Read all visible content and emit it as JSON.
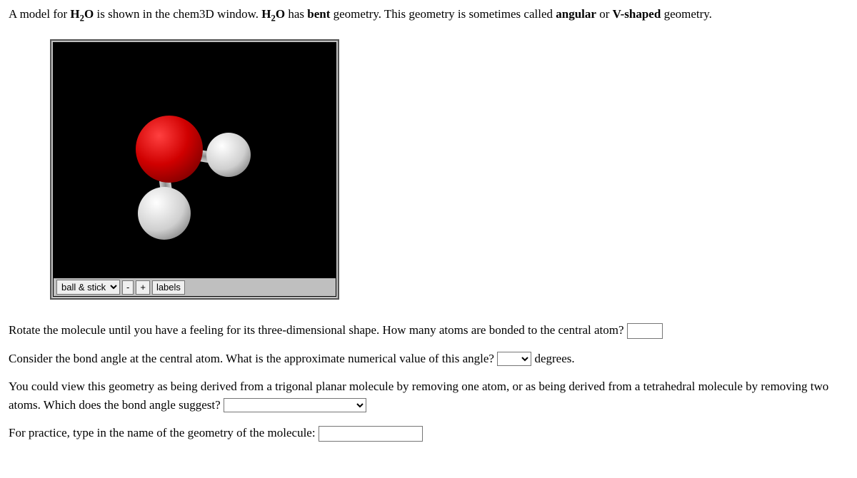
{
  "intro": {
    "pre1": "A model for ",
    "mol_prefix": "H",
    "mol_sub": "2",
    "mol_suffix": "O",
    "mid1": " is shown in the chem3D window. ",
    "mid2": " has ",
    "geom": "bent",
    "mid3": " geometry. This geometry is sometimes called ",
    "alt1": "angular",
    "mid4": " or ",
    "alt2": "V-shaped",
    "mid5": " geometry."
  },
  "toolbar": {
    "style_selected": "ball & stick",
    "minus": "-",
    "plus": "+",
    "labels": "labels"
  },
  "q1": {
    "text": "Rotate the molecule until you have a feeling for its three-dimensional shape. How many atoms are bonded to the central atom? "
  },
  "q2": {
    "text": "Consider the bond angle at the central atom. What is the approximate numerical value of this angle? ",
    "unit": " degrees."
  },
  "q3": {
    "text": "You could view this geometry as being derived from a trigonal planar molecule by removing one atom, or as being derived from a tetrahedral molecule by removing two atoms. Which does the bond angle suggest? "
  },
  "q4": {
    "text": "For practice, type in the name of the geometry of the molecule: "
  }
}
